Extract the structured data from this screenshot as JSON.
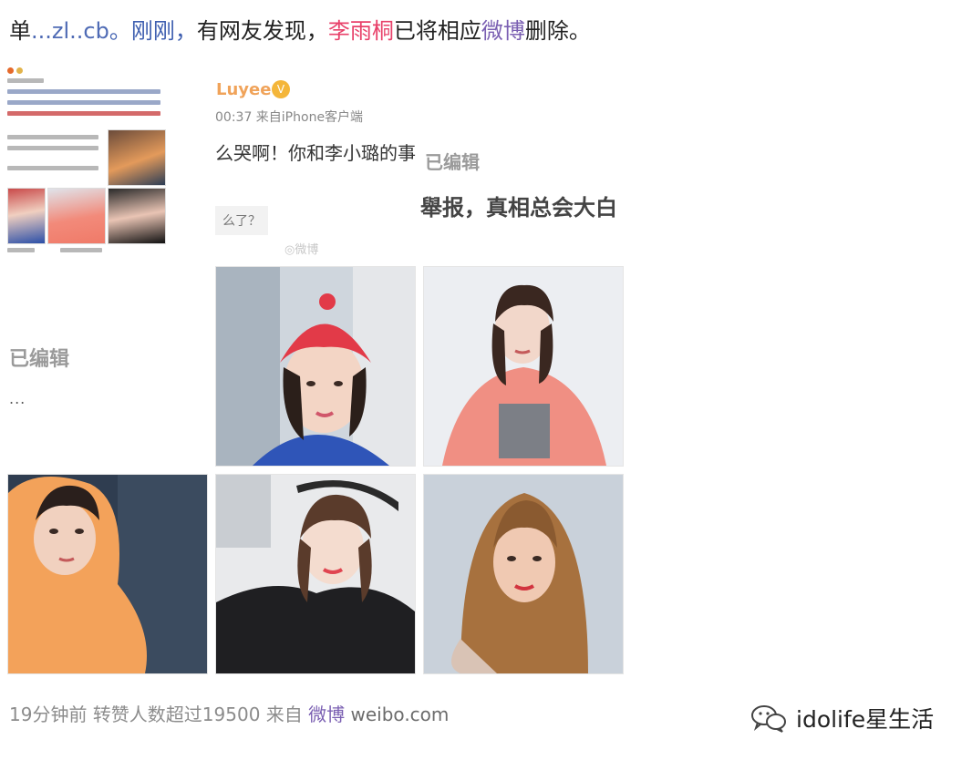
{
  "top_line": {
    "prefix": "单",
    "ellipsis_author": "...zl..cb",
    "sentence_1": "。刚刚，",
    "sentence_2": "有网友发现，",
    "name_red": "李雨桐",
    "sentence_3": "已将相应",
    "weibo": "微博",
    "sentence_4": "删除。"
  },
  "left_panel": {
    "edited_label": "已编辑",
    "ellipsis": "..."
  },
  "post": {
    "username": "Luyee",
    "vip_badge": "V",
    "meta": "00:37  来自iPhone客户端",
    "snippet_1": "么哭啊！你和李小璐的事",
    "edited_label": "已编辑",
    "snippet_2": "舉报，真相总会大白",
    "snippet_3": "么了？",
    "watermark": "◎微博"
  },
  "photos": [
    {
      "id": "photo-red-net-hat"
    },
    {
      "id": "photo-pink-hoodie"
    },
    {
      "id": "photo-orange-hoodie"
    },
    {
      "id": "photo-black-off-shoulder"
    },
    {
      "id": "photo-long-hair"
    }
  ],
  "footer": {
    "time": "19分钟前",
    "reposts": "转赞人数超过19500",
    "from": "来自",
    "source": "微博",
    "domain": "weibo.com"
  },
  "brand": {
    "icon": "wechat-icon",
    "name": "idolife星生活"
  },
  "colors": {
    "accent_blue": "#3f5fb0",
    "accent_red": "#e8416a",
    "accent_purple": "#7a5fb2",
    "vip_orange": "#f4b63a"
  }
}
